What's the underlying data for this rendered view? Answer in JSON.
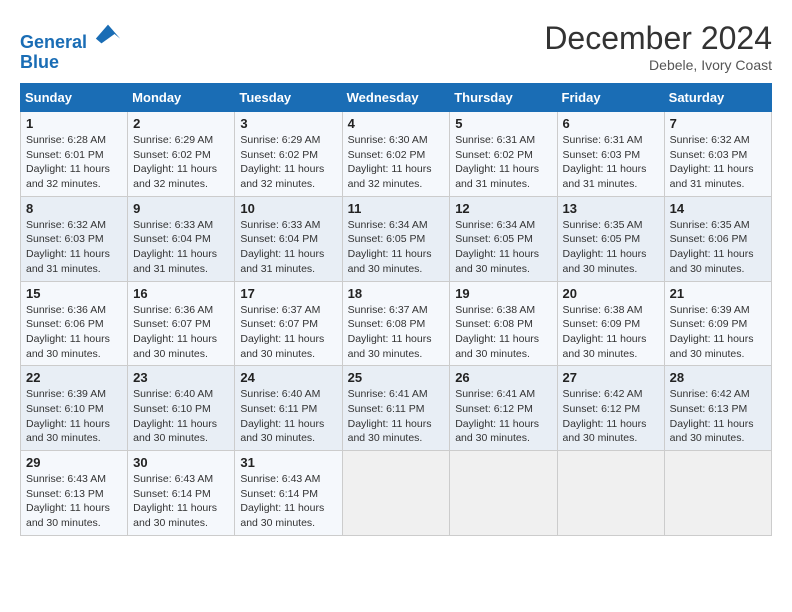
{
  "header": {
    "logo_line1": "General",
    "logo_line2": "Blue",
    "month": "December 2024",
    "location": "Debele, Ivory Coast"
  },
  "days_of_week": [
    "Sunday",
    "Monday",
    "Tuesday",
    "Wednesday",
    "Thursday",
    "Friday",
    "Saturday"
  ],
  "weeks": [
    [
      {
        "day": "1",
        "sunrise": "6:28 AM",
        "sunset": "6:01 PM",
        "daylight": "11 hours and 32 minutes."
      },
      {
        "day": "2",
        "sunrise": "6:29 AM",
        "sunset": "6:02 PM",
        "daylight": "11 hours and 32 minutes."
      },
      {
        "day": "3",
        "sunrise": "6:29 AM",
        "sunset": "6:02 PM",
        "daylight": "11 hours and 32 minutes."
      },
      {
        "day": "4",
        "sunrise": "6:30 AM",
        "sunset": "6:02 PM",
        "daylight": "11 hours and 32 minutes."
      },
      {
        "day": "5",
        "sunrise": "6:31 AM",
        "sunset": "6:02 PM",
        "daylight": "11 hours and 31 minutes."
      },
      {
        "day": "6",
        "sunrise": "6:31 AM",
        "sunset": "6:03 PM",
        "daylight": "11 hours and 31 minutes."
      },
      {
        "day": "7",
        "sunrise": "6:32 AM",
        "sunset": "6:03 PM",
        "daylight": "11 hours and 31 minutes."
      }
    ],
    [
      {
        "day": "8",
        "sunrise": "6:32 AM",
        "sunset": "6:03 PM",
        "daylight": "11 hours and 31 minutes."
      },
      {
        "day": "9",
        "sunrise": "6:33 AM",
        "sunset": "6:04 PM",
        "daylight": "11 hours and 31 minutes."
      },
      {
        "day": "10",
        "sunrise": "6:33 AM",
        "sunset": "6:04 PM",
        "daylight": "11 hours and 31 minutes."
      },
      {
        "day": "11",
        "sunrise": "6:34 AM",
        "sunset": "6:05 PM",
        "daylight": "11 hours and 30 minutes."
      },
      {
        "day": "12",
        "sunrise": "6:34 AM",
        "sunset": "6:05 PM",
        "daylight": "11 hours and 30 minutes."
      },
      {
        "day": "13",
        "sunrise": "6:35 AM",
        "sunset": "6:05 PM",
        "daylight": "11 hours and 30 minutes."
      },
      {
        "day": "14",
        "sunrise": "6:35 AM",
        "sunset": "6:06 PM",
        "daylight": "11 hours and 30 minutes."
      }
    ],
    [
      {
        "day": "15",
        "sunrise": "6:36 AM",
        "sunset": "6:06 PM",
        "daylight": "11 hours and 30 minutes."
      },
      {
        "day": "16",
        "sunrise": "6:36 AM",
        "sunset": "6:07 PM",
        "daylight": "11 hours and 30 minutes."
      },
      {
        "day": "17",
        "sunrise": "6:37 AM",
        "sunset": "6:07 PM",
        "daylight": "11 hours and 30 minutes."
      },
      {
        "day": "18",
        "sunrise": "6:37 AM",
        "sunset": "6:08 PM",
        "daylight": "11 hours and 30 minutes."
      },
      {
        "day": "19",
        "sunrise": "6:38 AM",
        "sunset": "6:08 PM",
        "daylight": "11 hours and 30 minutes."
      },
      {
        "day": "20",
        "sunrise": "6:38 AM",
        "sunset": "6:09 PM",
        "daylight": "11 hours and 30 minutes."
      },
      {
        "day": "21",
        "sunrise": "6:39 AM",
        "sunset": "6:09 PM",
        "daylight": "11 hours and 30 minutes."
      }
    ],
    [
      {
        "day": "22",
        "sunrise": "6:39 AM",
        "sunset": "6:10 PM",
        "daylight": "11 hours and 30 minutes."
      },
      {
        "day": "23",
        "sunrise": "6:40 AM",
        "sunset": "6:10 PM",
        "daylight": "11 hours and 30 minutes."
      },
      {
        "day": "24",
        "sunrise": "6:40 AM",
        "sunset": "6:11 PM",
        "daylight": "11 hours and 30 minutes."
      },
      {
        "day": "25",
        "sunrise": "6:41 AM",
        "sunset": "6:11 PM",
        "daylight": "11 hours and 30 minutes."
      },
      {
        "day": "26",
        "sunrise": "6:41 AM",
        "sunset": "6:12 PM",
        "daylight": "11 hours and 30 minutes."
      },
      {
        "day": "27",
        "sunrise": "6:42 AM",
        "sunset": "6:12 PM",
        "daylight": "11 hours and 30 minutes."
      },
      {
        "day": "28",
        "sunrise": "6:42 AM",
        "sunset": "6:13 PM",
        "daylight": "11 hours and 30 minutes."
      }
    ],
    [
      {
        "day": "29",
        "sunrise": "6:43 AM",
        "sunset": "6:13 PM",
        "daylight": "11 hours and 30 minutes."
      },
      {
        "day": "30",
        "sunrise": "6:43 AM",
        "sunset": "6:14 PM",
        "daylight": "11 hours and 30 minutes."
      },
      {
        "day": "31",
        "sunrise": "6:43 AM",
        "sunset": "6:14 PM",
        "daylight": "11 hours and 30 minutes."
      },
      null,
      null,
      null,
      null
    ]
  ]
}
